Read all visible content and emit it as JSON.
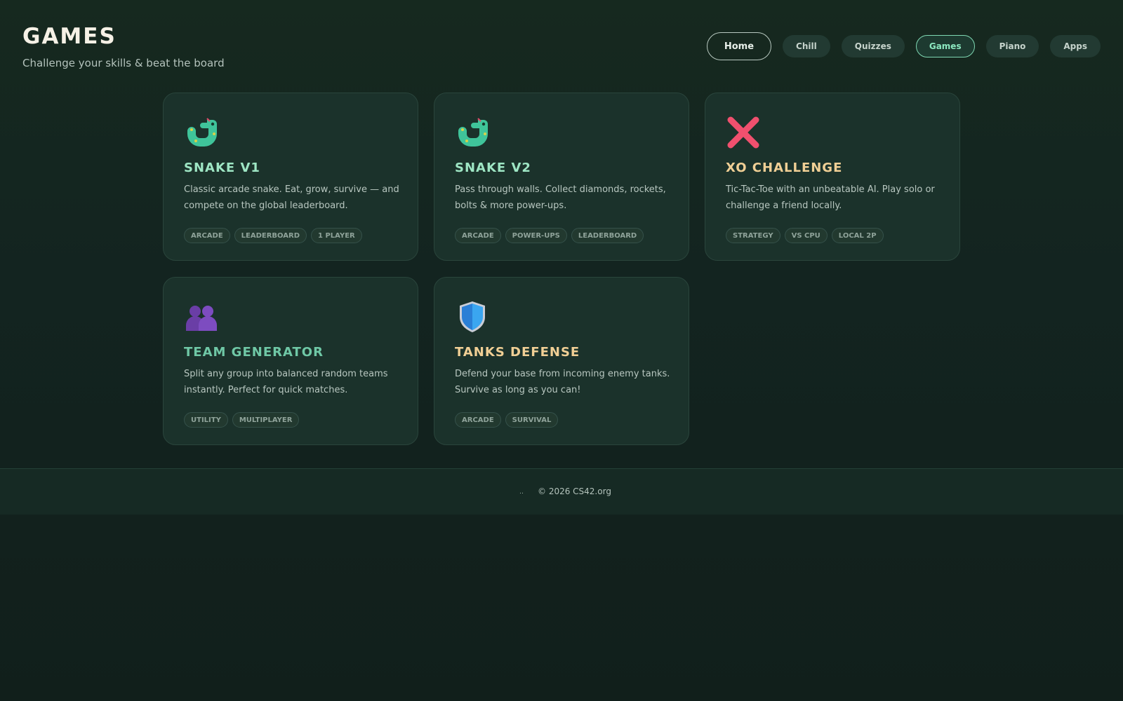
{
  "header": {
    "title": "GAMES",
    "subtitle": "Challenge your skills & beat the board"
  },
  "nav": [
    {
      "label": "Home"
    },
    {
      "label": "Chill"
    },
    {
      "label": "Quizzes"
    },
    {
      "label": "Games",
      "active": true
    },
    {
      "label": "Piano"
    },
    {
      "label": "Apps"
    }
  ],
  "colors": {
    "accent_green": "#7fd8b3",
    "title_mint": "#9ee6c4",
    "title_gold": "#f0cf95",
    "title_teal": "#6fc8a6"
  },
  "cards": [
    {
      "icon": "snake-icon",
      "title": "SNAKE V1",
      "description": "Classic arcade snake. Eat, grow, survive — and compete on the global leaderboard.",
      "tags": [
        "ARCADE",
        "LEADERBOARD",
        "1 PLAYER"
      ]
    },
    {
      "icon": "snake-icon",
      "title": "SNAKE V2",
      "description": "Pass through walls. Collect diamonds, rockets, bolts & more power-ups.",
      "tags": [
        "ARCADE",
        "POWER-UPS",
        "LEADERBOARD"
      ]
    },
    {
      "icon": "cross-mark-icon",
      "title": "XO CHALLENGE",
      "description": "Tic-Tac-Toe with an unbeatable AI. Play solo or challenge a friend locally.",
      "tags": [
        "STRATEGY",
        "VS CPU",
        "LOCAL 2P"
      ]
    },
    {
      "icon": "users-icon",
      "title": "TEAM GENERATOR",
      "description": "Split any group into balanced random teams instantly. Perfect for quick matches.",
      "tags": [
        "UTILITY",
        "MULTIPLAYER"
      ]
    },
    {
      "icon": "shield-icon",
      "title": "TANKS DEFENSE",
      "description": "Defend your base from incoming enemy tanks. Survive as long as you can!",
      "tags": [
        "ARCADE",
        "SURVIVAL"
      ]
    }
  ],
  "footer": {
    "mark": "‥",
    "copyright": "© 2026 CS42.org"
  }
}
